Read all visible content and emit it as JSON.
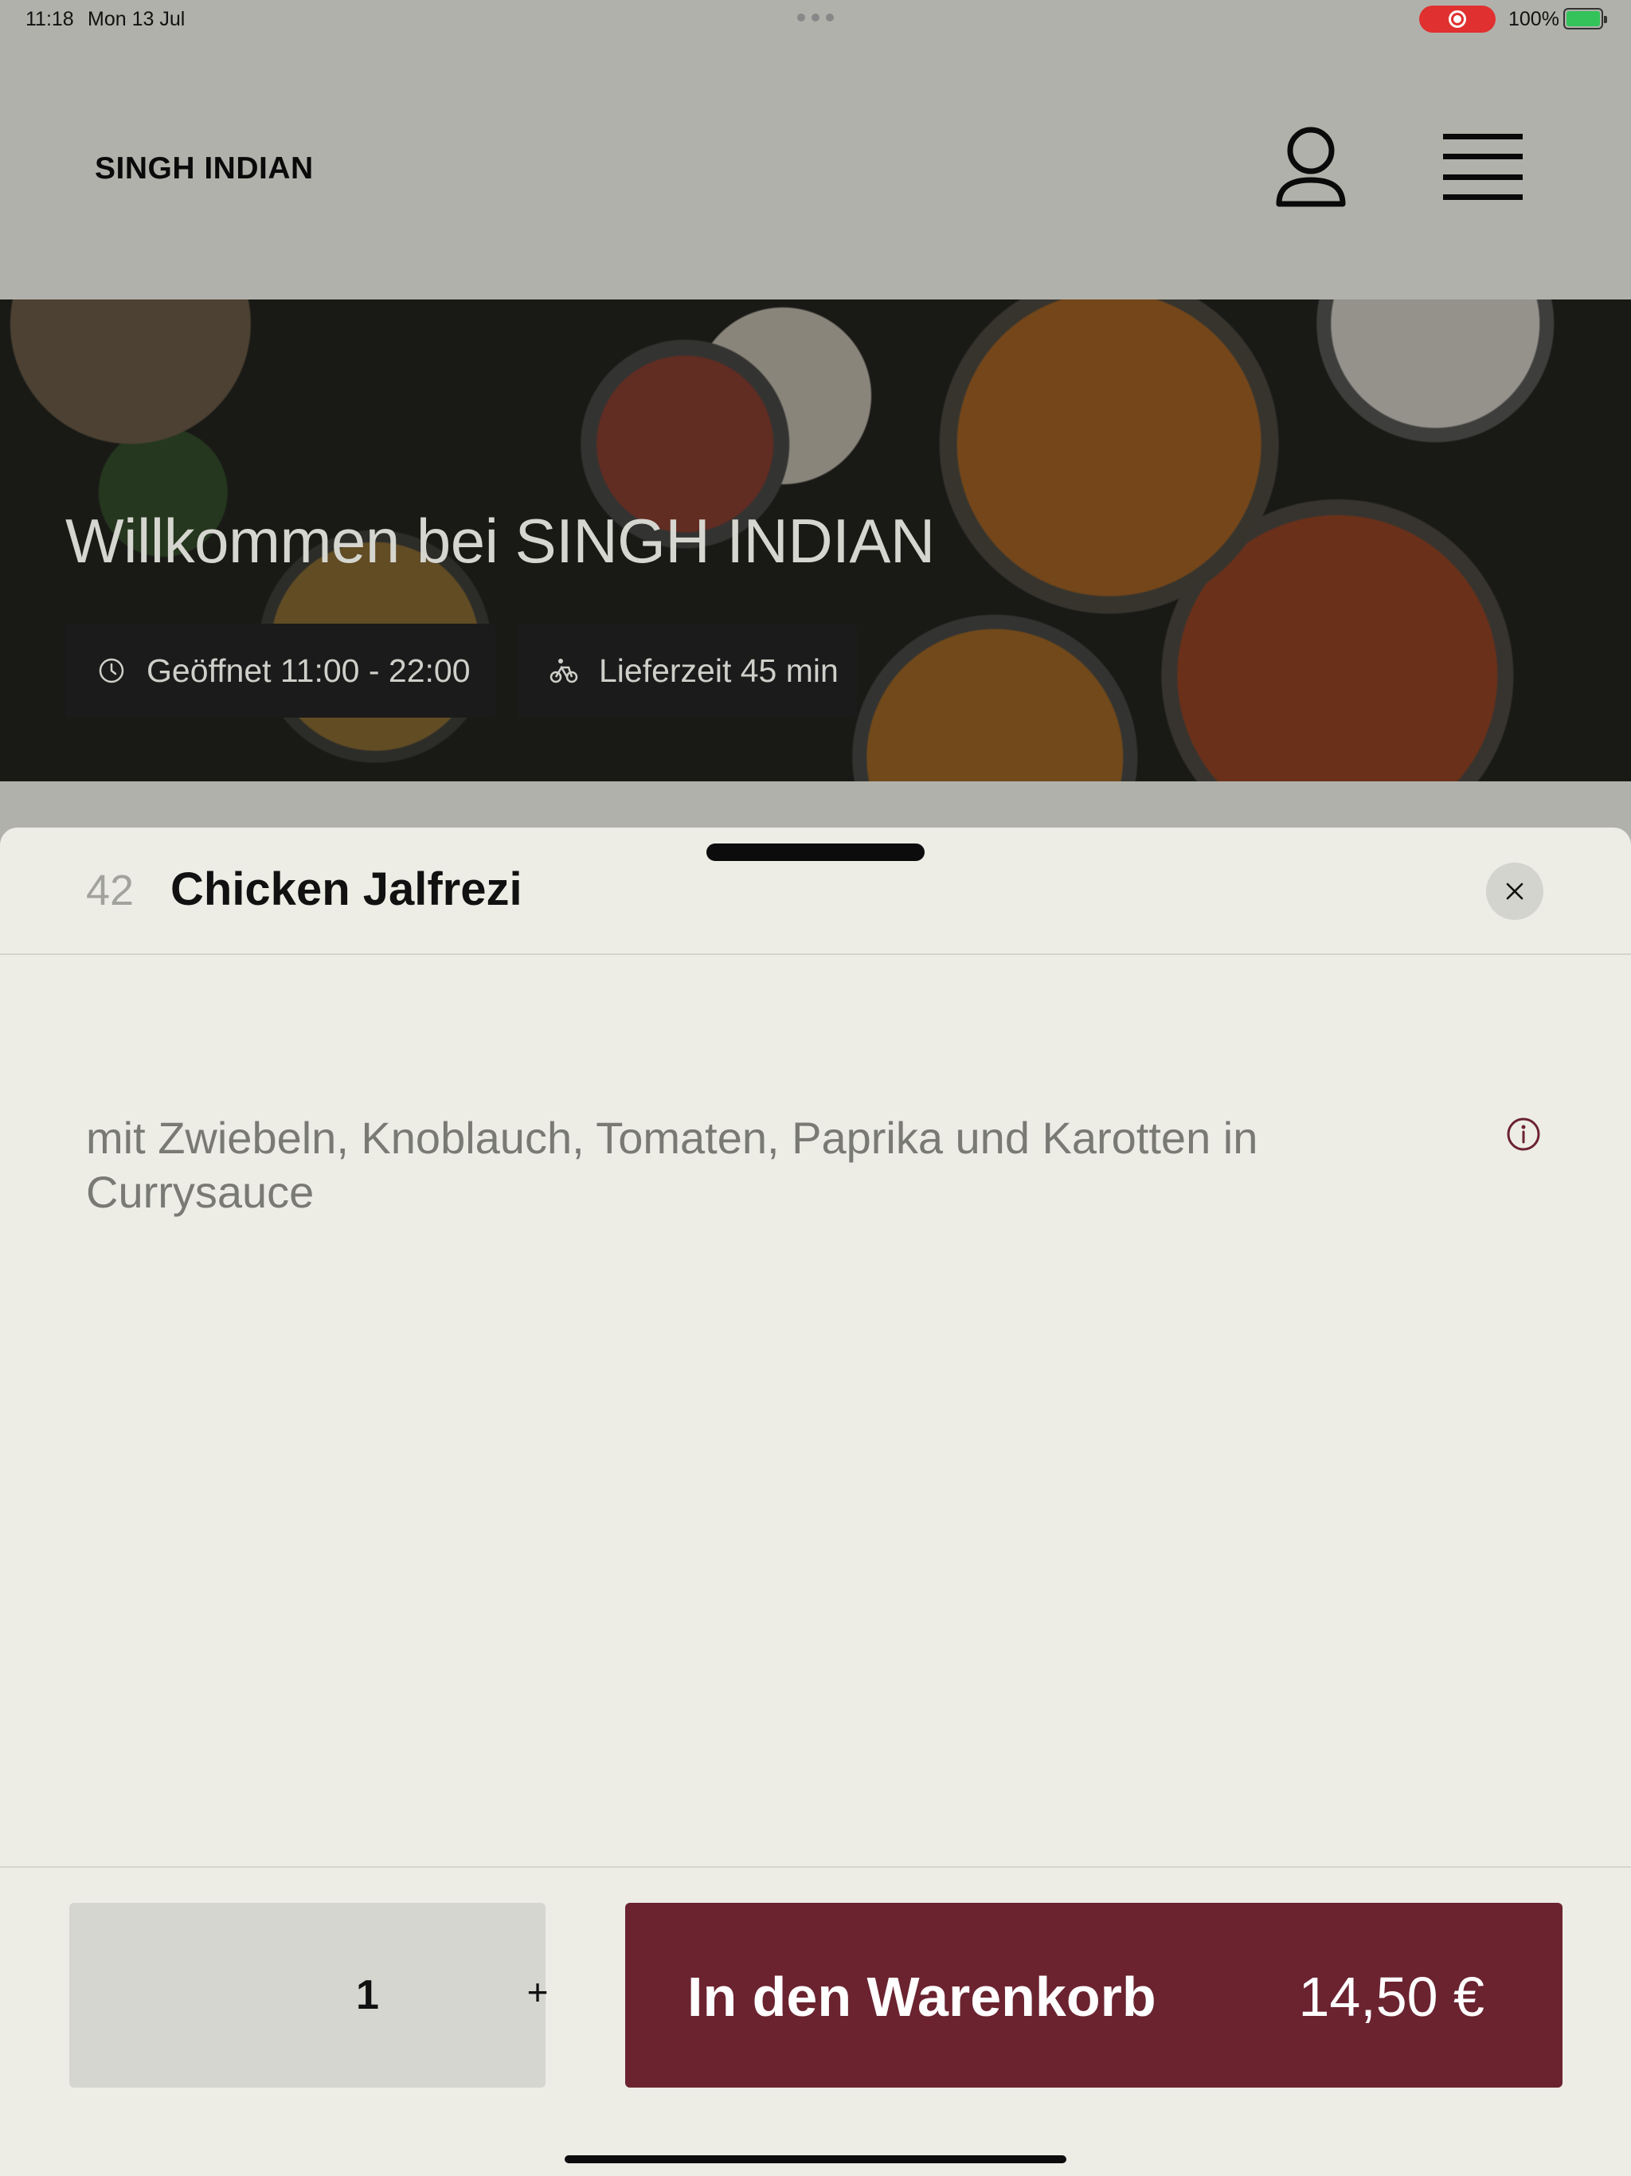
{
  "status_bar": {
    "time": "11:18",
    "date": "Mon 13 Jul",
    "battery": "100%",
    "icons": [
      "screen-recording-icon",
      "battery-charging-icon"
    ]
  },
  "header": {
    "brand": "SINGH INDIAN",
    "icons": [
      "user-icon",
      "hamburger-menu-icon"
    ]
  },
  "hero": {
    "title": "Willkommen bei SINGH INDIAN",
    "hours": "Geöffnet 11:00 - 22:00",
    "delivery": "Lieferzeit 45 min",
    "icons": [
      "clock-icon",
      "bicycle-icon"
    ]
  },
  "item": {
    "number": "42",
    "title": "Chicken Jalfrezi",
    "description": "mit Zwiebeln, Knoblauch, Tomaten, Paprika und Karotten in Currysauce",
    "icons": [
      "close-icon",
      "info-icon"
    ]
  },
  "order": {
    "quantity": "1",
    "plus": "+",
    "add_label": "In den Warenkorb",
    "price": "14,50 €"
  },
  "colors": {
    "accent": "#6b2330",
    "sheet_bg": "#edede6",
    "header_bg": "#b1b1ab",
    "chip_bg": "#1b1b1b"
  }
}
